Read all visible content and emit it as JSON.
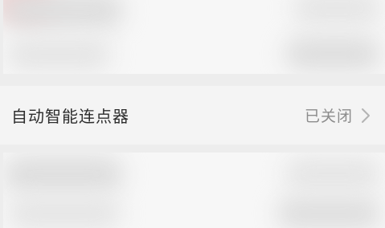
{
  "setting_row": {
    "title": "自动智能连点器",
    "status": "已关闭",
    "chevron_icon": "chevron-right-icon"
  }
}
